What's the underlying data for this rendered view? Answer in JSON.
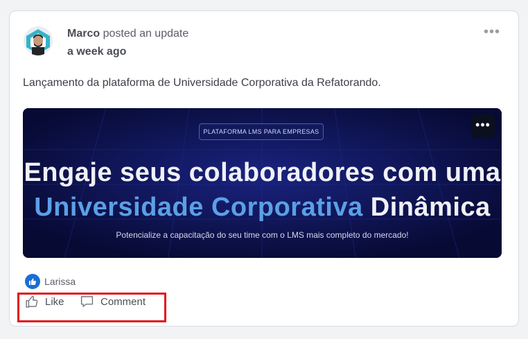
{
  "post": {
    "author": "Marco",
    "action_text": "posted an update",
    "time": "a week ago",
    "more_icon": "more-horizontal-icon",
    "text": "Lançamento da plataforma de Universidade Corporativa da Refatorando."
  },
  "banner": {
    "pill": "PLATAFORMA LMS PARA EMPRESAS",
    "headline_line1": "Engaje seus colaboradores com uma",
    "headline_line2_blue": "Universidade Corporativa",
    "headline_line2_white": "Dinâmica",
    "subtitle": "Potencialize a capacitação do seu time com o LMS mais completo do mercado!",
    "more_icon": "more-horizontal-icon"
  },
  "reactions": {
    "icon": "thumbs-up-icon",
    "names": "Larissa"
  },
  "actions": {
    "like_label": "Like",
    "comment_label": "Comment"
  },
  "colors": {
    "accent": "#1a6fd1",
    "highlight_border": "#e0141b",
    "banner_bg": "#0a0e3c",
    "banner_blue_text": "#5ba0e6"
  }
}
